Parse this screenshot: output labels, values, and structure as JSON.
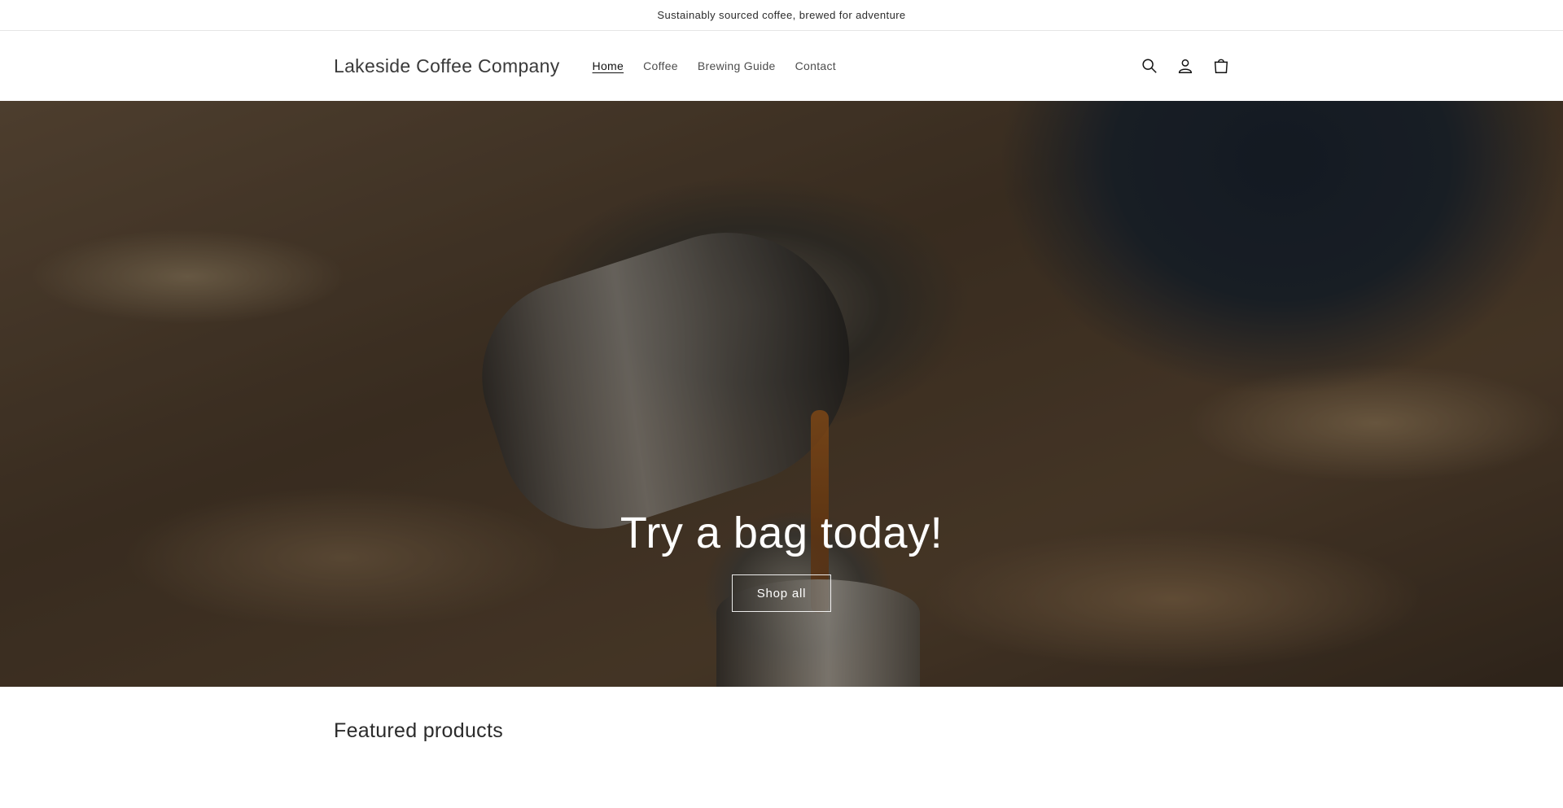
{
  "announcement": {
    "text": "Sustainably sourced coffee, brewed for adventure"
  },
  "header": {
    "logo": "Lakeside Coffee Company",
    "nav": [
      {
        "label": "Home",
        "active": true
      },
      {
        "label": "Coffee",
        "active": false
      },
      {
        "label": "Brewing Guide",
        "active": false
      },
      {
        "label": "Contact",
        "active": false
      }
    ],
    "icons": [
      "search-icon",
      "account-icon",
      "cart-icon"
    ]
  },
  "hero": {
    "title": "Try a bag today!",
    "button_label": "Shop all"
  },
  "featured": {
    "title": "Featured products"
  }
}
